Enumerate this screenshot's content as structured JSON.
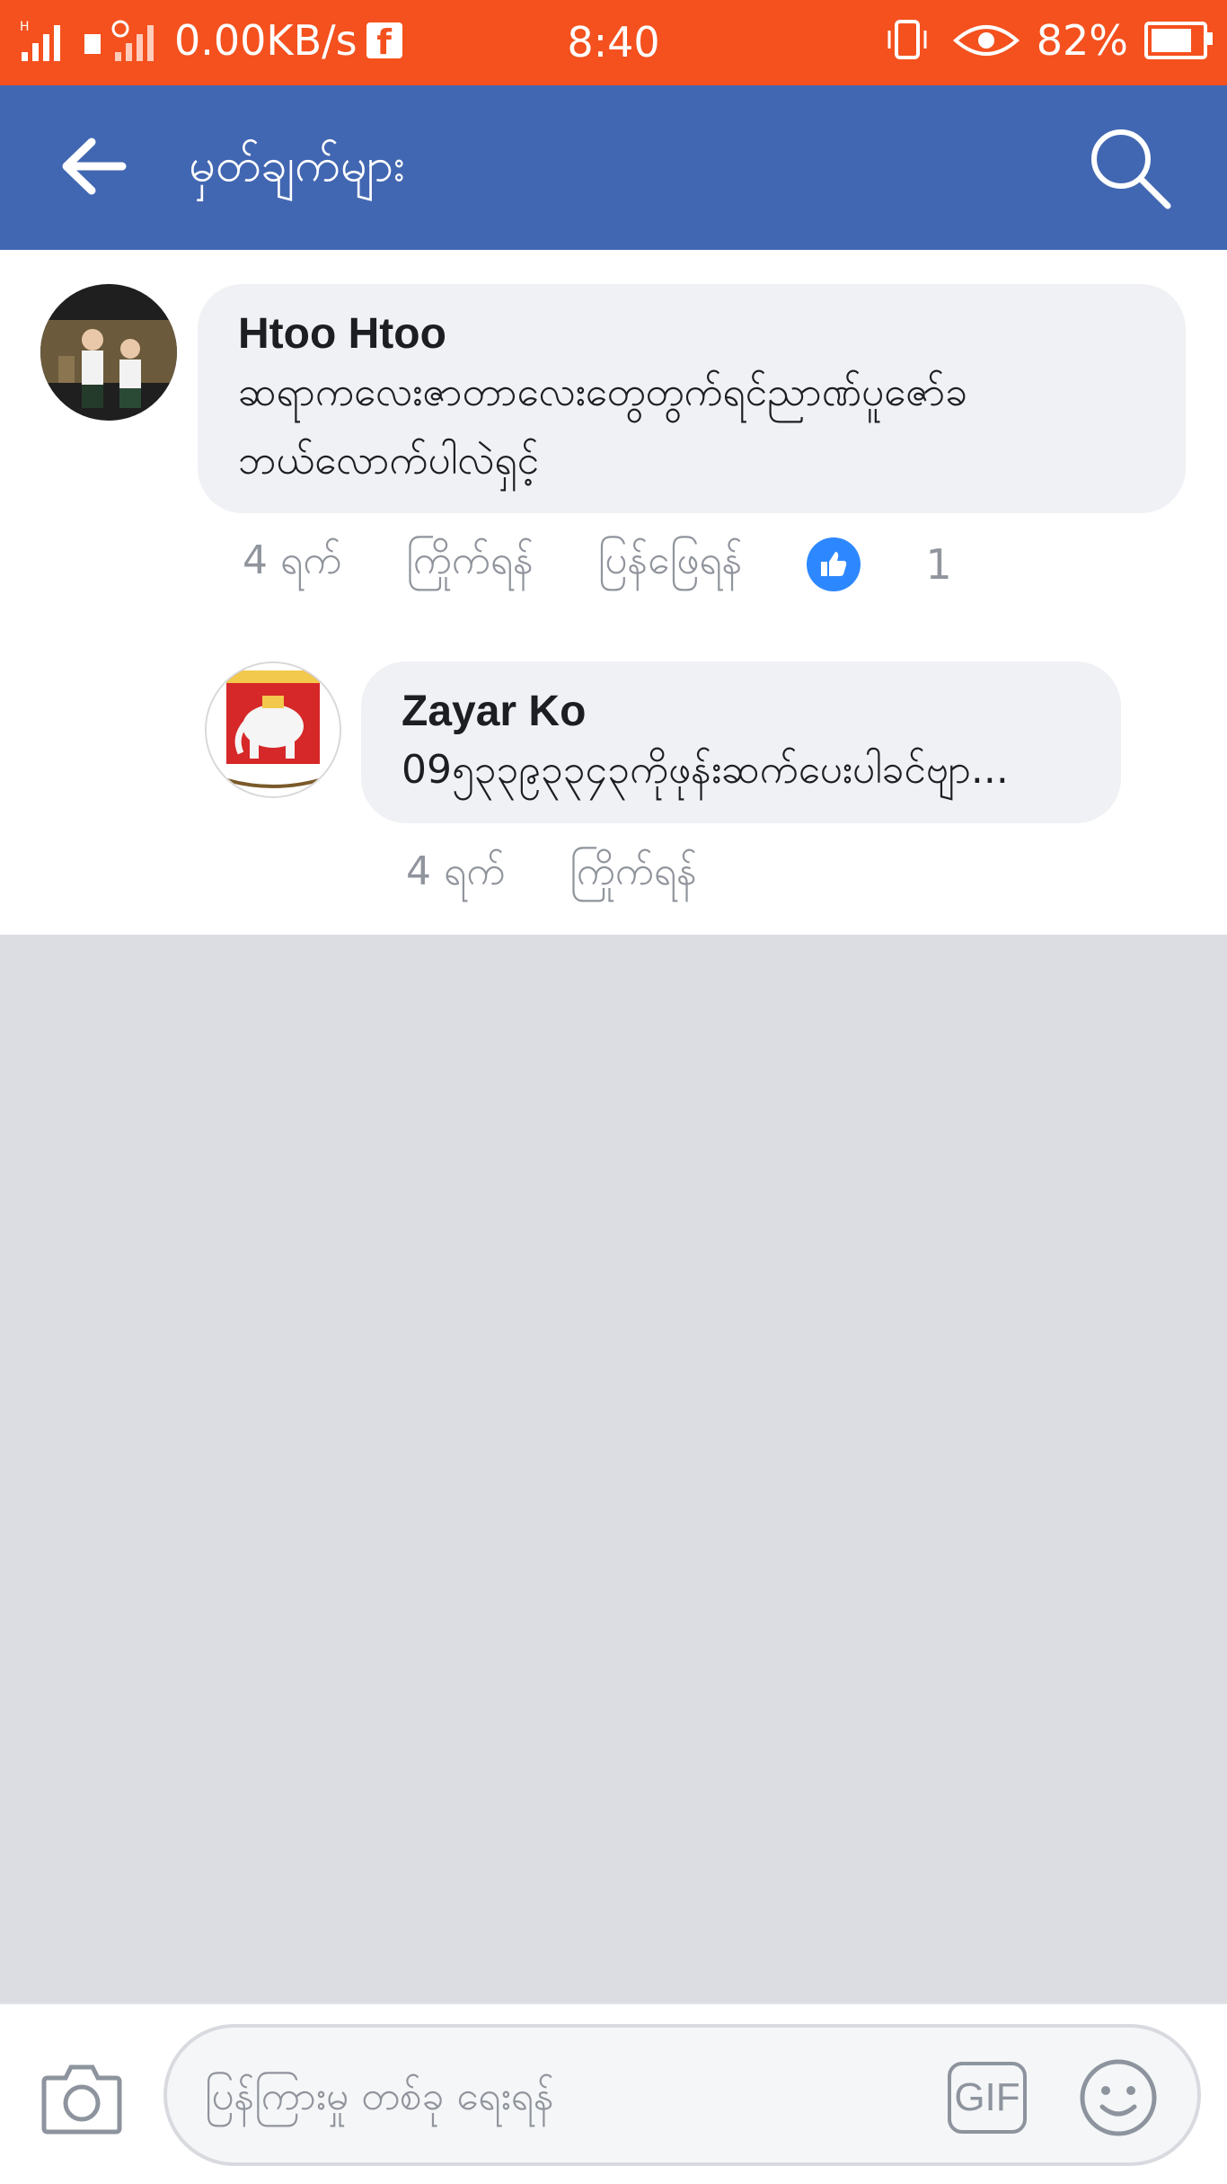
{
  "status_bar": {
    "network": "0.00KB/s",
    "time": "8:40",
    "battery_percent": "82%",
    "battery_level": 0.82,
    "icons": [
      "signal-icon",
      "sim-icon",
      "no-signal-icon",
      "facebook-icon",
      "vibrate-icon",
      "eye-icon",
      "battery-icon"
    ]
  },
  "app_bar": {
    "title": "မှတ်ချက်များ",
    "icons": [
      "back-arrow-icon",
      "search-icon"
    ]
  },
  "comments": [
    {
      "author": "Htoo Htoo",
      "text": "ဆရာကလေးဇာတာလေးတွေတွက်ရင်ညာဏ်ပူဇော်ခဘယ်လောက်ပါလဲရှင့်",
      "time": "4 ရက်",
      "like_label": "ကြိုက်ရန်",
      "reply_label": "ပြန်ဖြေရန်",
      "like_count": "1"
    },
    {
      "author": "Zayar Ko",
      "text": "09၅၃၃၉၃၃၄၃ကိုဖုန်းဆက်ပေးပါခင်ဗျာ...",
      "time": "4 ရက်",
      "like_label": "ကြိုက်ရန်"
    }
  ],
  "composer": {
    "placeholder": "ပြန်ကြားမှု တစ်ခု ရေးရန်",
    "gif_label": "GIF",
    "icons": [
      "camera-icon",
      "gif-icon",
      "emoji-icon"
    ]
  },
  "colors": {
    "status_bar": "#f4511e",
    "app_bar": "#4267b2",
    "like_badge": "#2d88ff",
    "bubble": "#f0f1f4",
    "background": "#dcdde2"
  }
}
